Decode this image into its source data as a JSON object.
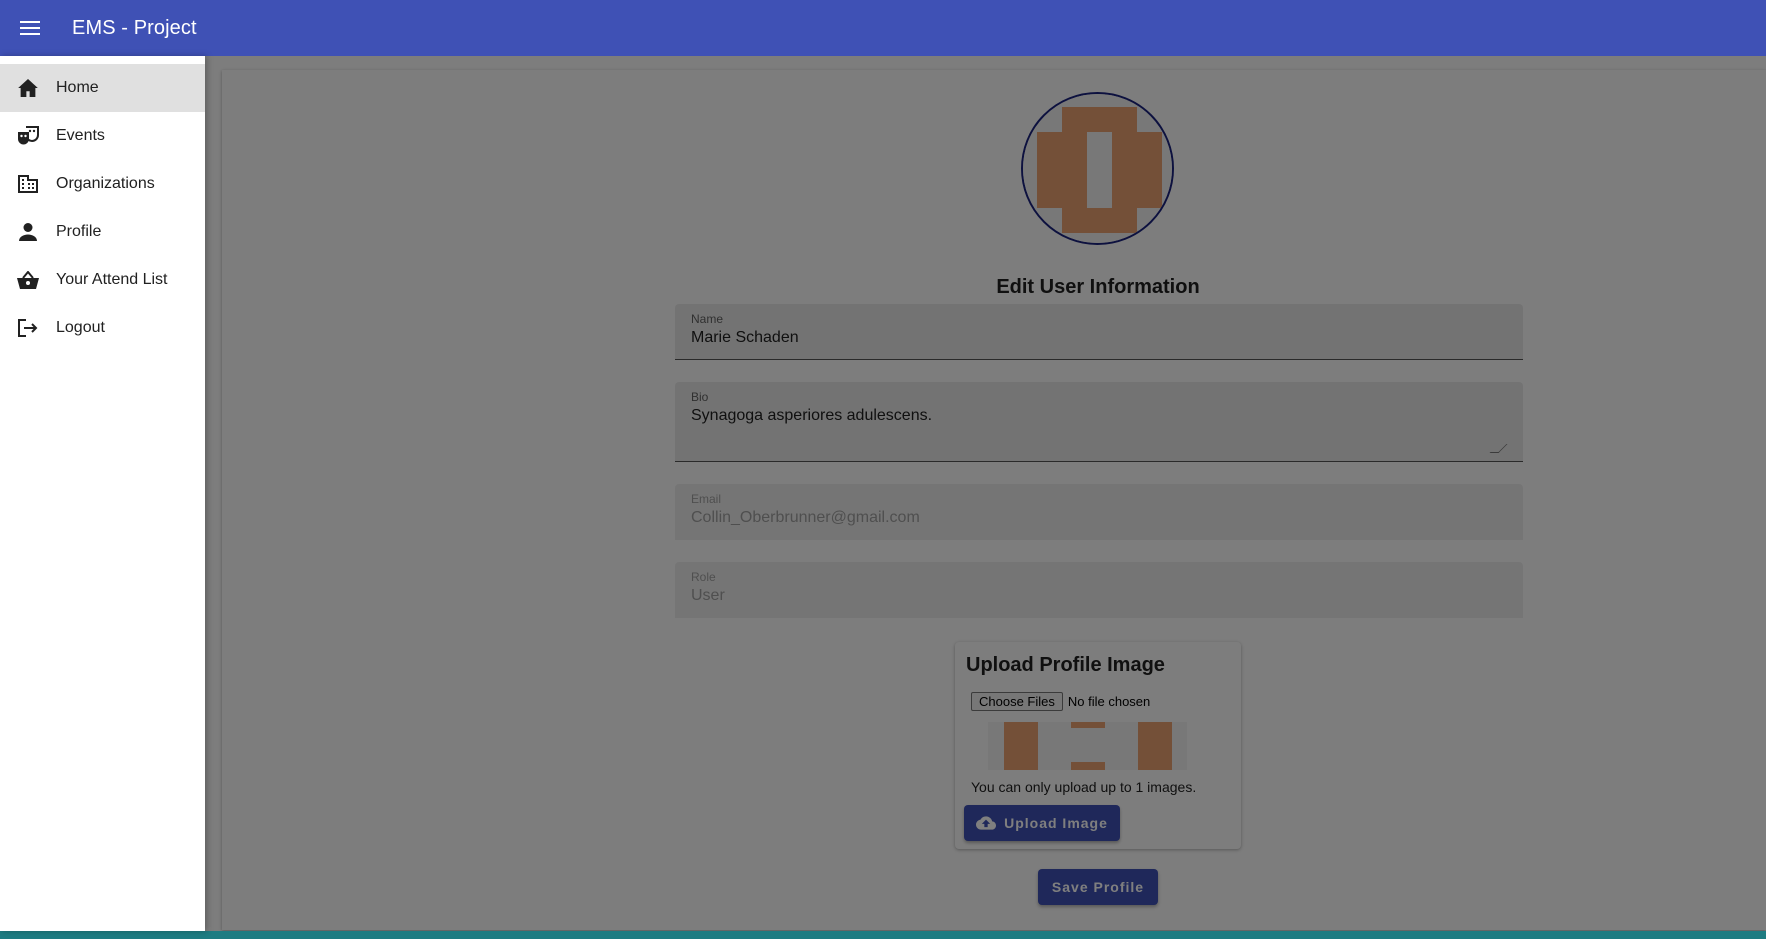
{
  "appbar": {
    "title": "EMS - Project",
    "menu_icon": "menu-icon",
    "color": "#3f51b5"
  },
  "sidebar": {
    "items": [
      {
        "label": "Home",
        "icon": "home-icon",
        "selected": true
      },
      {
        "label": "Events",
        "icon": "theater-masks-icon",
        "selected": false
      },
      {
        "label": "Organizations",
        "icon": "building-icon",
        "selected": false
      },
      {
        "label": "Profile",
        "icon": "person-icon",
        "selected": false
      },
      {
        "label": "Your Attend List",
        "icon": "basket-icon",
        "selected": false
      },
      {
        "label": "Logout",
        "icon": "logout-icon",
        "selected": false
      }
    ]
  },
  "form": {
    "title": "Edit User Information",
    "name": {
      "label": "Name",
      "value": "Marie Schaden"
    },
    "bio": {
      "label": "Bio",
      "value": "Synagoga asperiores adulescens."
    },
    "email": {
      "label": "Email",
      "value": "Collin_Oberbrunner@gmail.com"
    },
    "role": {
      "label": "Role",
      "value": "User"
    }
  },
  "upload": {
    "title": "Upload Profile Image",
    "choose_label": "Choose Files",
    "file_status": "No file chosen",
    "note": "You can only upload up to 1 images.",
    "button_label": "Upload Image",
    "button_icon": "cloud-upload-icon"
  },
  "save_label": "Save Profile",
  "colors": {
    "primary": "#3f51b5",
    "avatar_pattern": "#e8a070",
    "avatar_border": "#1a237e"
  }
}
